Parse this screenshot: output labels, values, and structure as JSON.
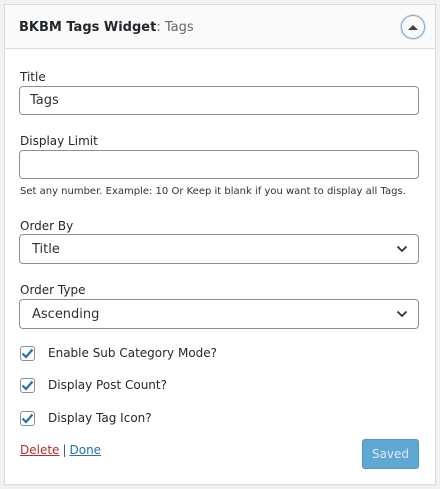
{
  "widget": {
    "name": "BKBM Tags Widget",
    "title_suffix": ": Tags"
  },
  "fields": {
    "title": {
      "label": "Title",
      "value": "Tags"
    },
    "display_limit": {
      "label": "Display Limit",
      "value": "",
      "help": "Set any number. Example: 10 Or Keep it blank if you want to display all Tags."
    },
    "order_by": {
      "label": "Order By",
      "selected": "Title"
    },
    "order_type": {
      "label": "Order Type",
      "selected": "Ascending"
    }
  },
  "checkboxes": [
    {
      "label": "Enable Sub Category Mode?",
      "checked": true
    },
    {
      "label": "Display Post Count?",
      "checked": true
    },
    {
      "label": "Display Tag Icon?",
      "checked": true
    }
  ],
  "actions": {
    "delete_label": "Delete",
    "separator": "|",
    "done_label": "Done",
    "saved_label": "Saved"
  },
  "colors": {
    "delete_link": "#b32d2e",
    "done_link": "#2271b1",
    "saved_button": "#5fa8d3",
    "checkmark": "#2271b1"
  }
}
